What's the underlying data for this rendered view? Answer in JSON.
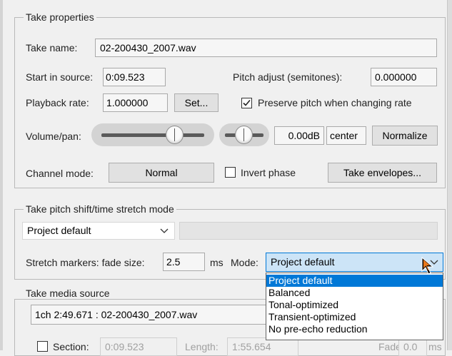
{
  "take_properties": {
    "title": "Take properties",
    "take_name_label": "Take name:",
    "take_name_value": "02-200430_2007.wav",
    "start_in_source_label": "Start in source:",
    "start_in_source_value": "0:09.523",
    "pitch_adjust_label": "Pitch adjust (semitones):",
    "pitch_adjust_value": "0.000000",
    "playback_rate_label": "Playback rate:",
    "playback_rate_value": "1.000000",
    "set_button": "Set...",
    "preserve_pitch_label": "Preserve pitch when changing rate",
    "preserve_pitch_checked": true,
    "volume_pan_label": "Volume/pan:",
    "volume_value": "0.00dB",
    "pan_value": "center",
    "normalize_button": "Normalize",
    "channel_mode_label": "Channel mode:",
    "channel_mode_value": "Normal",
    "invert_phase_label": "Invert phase",
    "invert_phase_checked": false,
    "take_envelopes_button": "Take envelopes..."
  },
  "pitch_shift": {
    "title": "Take pitch shift/time stretch mode",
    "mode_select": "Project default",
    "stretch_markers_label": "Stretch markers: fade size:",
    "fade_size_value": "2.5",
    "ms_label": "ms",
    "mode_label": "Mode:",
    "mode_value": "Project default",
    "options": [
      "Project default",
      "Balanced",
      "Tonal-optimized",
      "Transient-optimized",
      "No pre-echo reduction"
    ],
    "selected_index": 0
  },
  "media_source": {
    "title": "Take media source",
    "source_value": "1ch 2:49.671 : 02-200430_2007.wav",
    "section_label": "Section:",
    "section_start": "0:09.523",
    "length_label": "Length:",
    "length_value": "1:55.654",
    "fade_label": "Fade:",
    "fade_value": "0.0",
    "ms_label": "ms"
  }
}
